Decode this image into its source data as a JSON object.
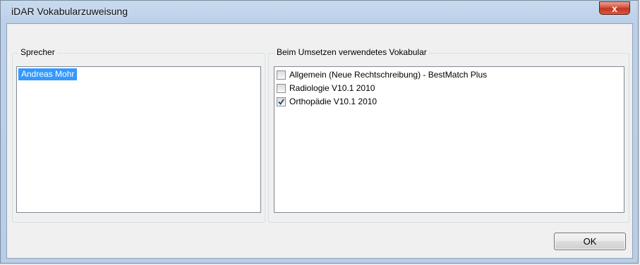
{
  "window": {
    "title": "iDAR Vokabularzuweisung",
    "close_symbol": "x"
  },
  "speaker_group": {
    "label": "Sprecher",
    "items": [
      {
        "label": "Andreas Mohr",
        "selected": true
      }
    ]
  },
  "vocab_group": {
    "label": "Beim Umsetzen verwendetes Vokabular",
    "items": [
      {
        "label": "Allgemein (Neue Rechtschreibung) - BestMatch Plus",
        "checked": false
      },
      {
        "label": "Radiologie V10.1 2010",
        "checked": false
      },
      {
        "label": "Orthopädie V10.1 2010",
        "checked": true
      }
    ]
  },
  "buttons": {
    "ok_label": "OK"
  },
  "colors": {
    "selection": "#3399ff",
    "close_button": "#c9412a",
    "titlebar": "#bcd0ea"
  }
}
